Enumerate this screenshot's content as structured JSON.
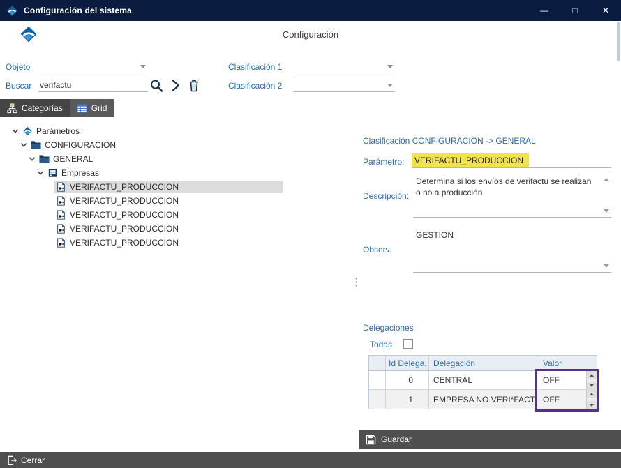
{
  "window": {
    "title": "Configuración del sistema",
    "controls": {
      "minimize": "—",
      "maximize": "□",
      "close": "✕"
    }
  },
  "header": {
    "title": "Configuración"
  },
  "filters": {
    "objeto": {
      "label": "Objeto",
      "value": ""
    },
    "buscar": {
      "label": "Buscar",
      "value": "verifactu"
    },
    "clasificacion1": {
      "label": "Clasificación 1",
      "value": ""
    },
    "clasificacion2": {
      "label": "Clasificación 2",
      "value": ""
    }
  },
  "tabs": {
    "categorias": "Categorías",
    "grid": "Grid"
  },
  "tree": {
    "items": [
      {
        "label": "Parámetros",
        "level": 0,
        "icon": "logo",
        "expander": true
      },
      {
        "label": "CONFIGURACION",
        "level": 1,
        "icon": "folder",
        "expander": true
      },
      {
        "label": "GENERAL",
        "level": 2,
        "icon": "folder",
        "expander": true
      },
      {
        "label": "Empresas",
        "level": 3,
        "icon": "building",
        "expander": true
      },
      {
        "label": "VERIFACTU_PRODUCCION",
        "level": 4,
        "icon": "param",
        "selected": true
      },
      {
        "label": "VERIFACTU_PRODUCCION",
        "level": 4,
        "icon": "param"
      },
      {
        "label": "VERIFACTU_PRODUCCION",
        "level": 4,
        "icon": "param"
      },
      {
        "label": "VERIFACTU_PRODUCCION",
        "level": 4,
        "icon": "param"
      },
      {
        "label": "VERIFACTU_PRODUCCION",
        "level": 4,
        "icon": "param"
      }
    ]
  },
  "detail": {
    "classification": "Clasificación CONFIGURACION -> GENERAL",
    "parametro": {
      "label": "Parámetro:",
      "value": "VERIFACTU_PRODUCCION"
    },
    "descripcion": {
      "label": "Descripción:",
      "value": "Determina si los envíos de verifactu se realizan o no a producción"
    },
    "observ": {
      "label": "Observ.",
      "value": "GESTION"
    },
    "delegaciones": {
      "title": "Delegaciones",
      "todas_label": "Todas",
      "todas_checked": false,
      "columns": [
        "Id Delega...",
        "Delegación",
        "Valor"
      ],
      "rows": [
        {
          "id": "0",
          "delegacion": "CENTRAL",
          "valor": "OFF"
        },
        {
          "id": "1",
          "delegacion": "EMPRESA NO VERI*FACTU",
          "valor": "OFF"
        }
      ]
    },
    "guardar_label": "Guardar"
  },
  "statusbar": {
    "cerrar_label": "Cerrar"
  },
  "colors": {
    "titlebar": "#0a1c3f",
    "accent": "#2e6da4",
    "highlight": "#f3e24b",
    "valor_border": "#5c2d91",
    "bar": "#4f4f4f"
  }
}
